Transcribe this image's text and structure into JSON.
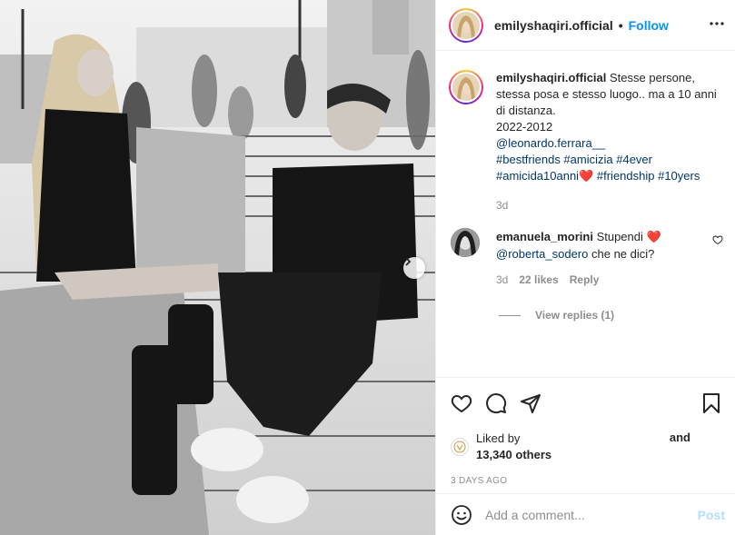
{
  "header": {
    "username": "emilyshaqiri.official",
    "separator": "•",
    "follow_label": "Follow"
  },
  "caption": {
    "username": "emilyshaqiri.official",
    "line1": "Stesse persone, stessa posa e stesso luogo.. ma a 10 anni di distanza.",
    "line2": "2022-2012",
    "mention": "@leonardo.ferrara__",
    "hashtags_1": "#bestfriends #amicizia #4ever",
    "hashtag_amicida": "#amicida10anni",
    "heart_emoji": "❤️",
    "hashtags_2": "#friendship #10yers",
    "time": "3d"
  },
  "comment": {
    "username": "emanuela_morini",
    "text": "Stupendi",
    "heart_emoji": "❤️",
    "mention": "@roberta_sodero",
    "text2": "che ne dici?",
    "time": "3d",
    "likes": "22 likes",
    "reply_label": "Reply",
    "view_replies": "View replies (1)"
  },
  "likes": {
    "liked_by": "Liked by",
    "count": "13,340 others",
    "and": "and"
  },
  "date": "3 DAYS AGO",
  "add_comment": {
    "placeholder": "Add a comment...",
    "post_label": "Post"
  },
  "colors": {
    "accent": "#0095f6",
    "post_disabled": "#b2dffc",
    "heart": "#ed4956",
    "muted": "#8e8e8e"
  },
  "icons": [
    "more-icon",
    "heart-icon",
    "comment-icon",
    "share-icon",
    "save-icon",
    "emoji-icon",
    "chevron-right-icon"
  ]
}
